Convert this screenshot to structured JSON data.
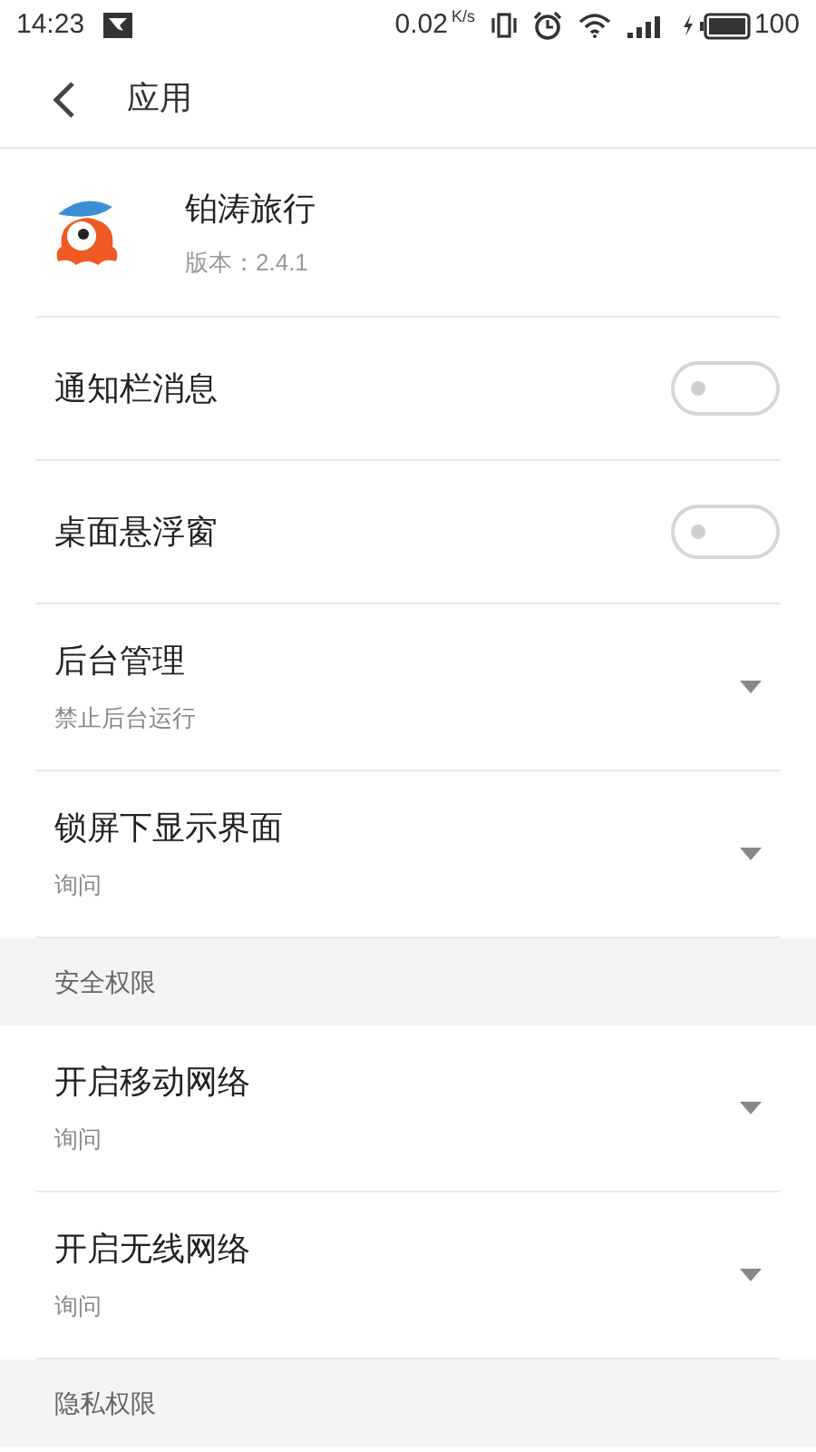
{
  "status_bar": {
    "time": "14:23",
    "speed": "0.02",
    "speed_unit": "K/s",
    "battery": "100"
  },
  "nav": {
    "title": "应用"
  },
  "app": {
    "name": "铂涛旅行",
    "version": "版本：2.4.1"
  },
  "items": [
    {
      "kind": "toggle",
      "label": "通知栏消息",
      "on": false
    },
    {
      "kind": "toggle",
      "label": "桌面悬浮窗",
      "on": false
    },
    {
      "kind": "dropdown",
      "label": "后台管理",
      "value": "禁止后台运行"
    },
    {
      "kind": "dropdown",
      "label": "锁屏下显示界面",
      "value": "询问"
    },
    {
      "kind": "section",
      "label": "安全权限"
    },
    {
      "kind": "dropdown",
      "label": "开启移动网络",
      "value": "询问"
    },
    {
      "kind": "dropdown",
      "label": "开启无线网络",
      "value": "询问"
    },
    {
      "kind": "section",
      "label": "隐私权限"
    }
  ]
}
